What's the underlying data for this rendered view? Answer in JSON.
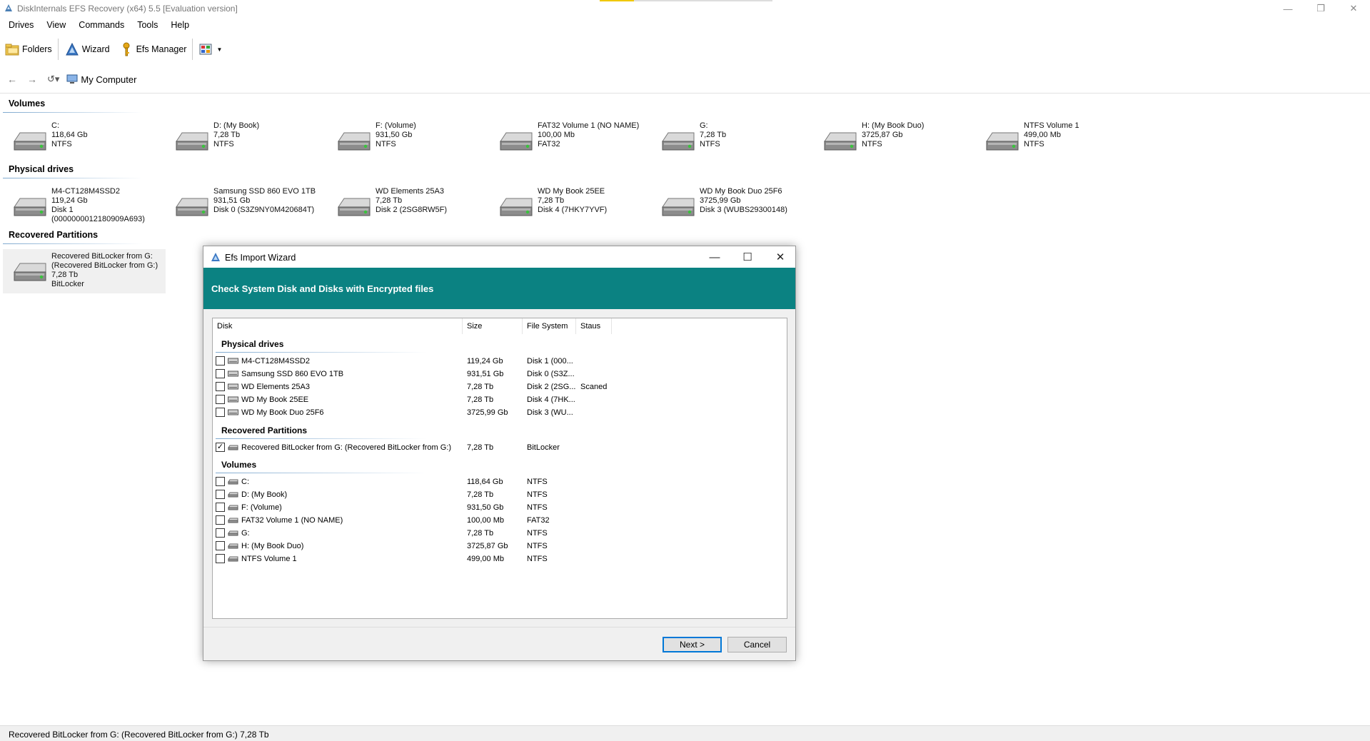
{
  "window": {
    "title": "DiskInternals EFS Recovery (x64) 5.5 [Evaluation version]"
  },
  "menu": [
    "Drives",
    "View",
    "Commands",
    "Tools",
    "Help"
  ],
  "toolbar": {
    "folders": "Folders",
    "wizard": "Wizard",
    "efs_manager": "Efs Manager"
  },
  "nav": {
    "location": "My Computer"
  },
  "sections": {
    "volumes": "Volumes",
    "physical": "Physical drives",
    "recovered": "Recovered Partitions"
  },
  "volumes": [
    [
      "C:",
      "118,64 Gb",
      "NTFS"
    ],
    [
      "D: (My Book)",
      "7,28 Tb",
      "NTFS"
    ],
    [
      "F: (Volume)",
      "931,50 Gb",
      "NTFS"
    ],
    [
      "FAT32 Volume 1 (NO NAME)",
      "100,00 Mb",
      "FAT32"
    ],
    [
      "G:",
      "7,28 Tb",
      "NTFS"
    ],
    [
      "H: (My Book Duo)",
      "3725,87 Gb",
      "NTFS"
    ],
    [
      "NTFS Volume 1",
      "499,00 Mb",
      "NTFS"
    ]
  ],
  "physical": [
    [
      "M4-CT128M4SSD2",
      "119,24 Gb",
      "Disk 1",
      "(0000000012180909A693)"
    ],
    [
      "Samsung SSD 860 EVO 1TB",
      "931,51 Gb",
      "Disk 0 (S3Z9NY0M420684T)",
      ""
    ],
    [
      "WD Elements 25A3",
      "7,28 Tb",
      "Disk 2 (2SG8RW5F)",
      ""
    ],
    [
      "WD My Book 25EE",
      "7,28 Tb",
      "Disk 4 (7HKY7YVF)",
      ""
    ],
    [
      "WD My Book Duo 25F6",
      "3725,99 Gb",
      "Disk 3 (WUBS29300148)",
      ""
    ]
  ],
  "recovered": [
    [
      "Recovered BitLocker from G:",
      "(Recovered BitLocker from G:)",
      "7,28 Tb",
      "BitLocker"
    ]
  ],
  "dialog": {
    "title": "Efs Import Wizard",
    "header": "Check System Disk and Disks with Encrypted files",
    "columns": [
      "Disk",
      "Size",
      "File System",
      "Staus"
    ],
    "groups": {
      "physical": "Physical drives",
      "recovered": "Recovered Partitions",
      "volumes": "Volumes"
    },
    "physical_rows": [
      {
        "name": "M4-CT128M4SSD2",
        "size": "119,24 Gb",
        "fs": "Disk 1 (000...",
        "status": "",
        "checked": false
      },
      {
        "name": "Samsung SSD 860 EVO 1TB",
        "size": "931,51 Gb",
        "fs": "Disk 0 (S3Z...",
        "status": "",
        "checked": false
      },
      {
        "name": "WD Elements 25A3",
        "size": "7,28 Tb",
        "fs": "Disk 2 (2SG...",
        "status": "Scaned",
        "checked": false
      },
      {
        "name": "WD My Book 25EE",
        "size": "7,28 Tb",
        "fs": "Disk 4 (7HK...",
        "status": "",
        "checked": false
      },
      {
        "name": "WD My Book Duo 25F6",
        "size": "3725,99 Gb",
        "fs": "Disk 3 (WU...",
        "status": "",
        "checked": false
      }
    ],
    "recovered_rows": [
      {
        "name": "Recovered BitLocker from G: (Recovered BitLocker from G:)",
        "size": "7,28 Tb",
        "fs": "BitLocker",
        "status": "",
        "checked": true
      }
    ],
    "volume_rows": [
      {
        "name": "C:",
        "size": "118,64 Gb",
        "fs": "NTFS",
        "status": "",
        "checked": false
      },
      {
        "name": "D: (My Book)",
        "size": "7,28 Tb",
        "fs": "NTFS",
        "status": "",
        "checked": false
      },
      {
        "name": "F: (Volume)",
        "size": "931,50 Gb",
        "fs": "NTFS",
        "status": "",
        "checked": false
      },
      {
        "name": "FAT32 Volume 1 (NO NAME)",
        "size": "100,00 Mb",
        "fs": "FAT32",
        "status": "",
        "checked": false
      },
      {
        "name": "G:",
        "size": "7,28 Tb",
        "fs": "NTFS",
        "status": "",
        "checked": false
      },
      {
        "name": "H: (My Book Duo)",
        "size": "3725,87 Gb",
        "fs": "NTFS",
        "status": "",
        "checked": false
      },
      {
        "name": "NTFS Volume 1",
        "size": "499,00 Mb",
        "fs": "NTFS",
        "status": "",
        "checked": false
      }
    ],
    "next": "Next >",
    "cancel": "Cancel"
  },
  "status": "Recovered BitLocker from G: (Recovered BitLocker from G:) 7,28 Tb",
  "colors": {
    "header_teal": "#0b8282",
    "accent_blue": "#0078d7"
  },
  "icons": {
    "app": "efs-app-icon",
    "hdd": "hard-drive-icon",
    "computer": "my-computer-icon"
  }
}
